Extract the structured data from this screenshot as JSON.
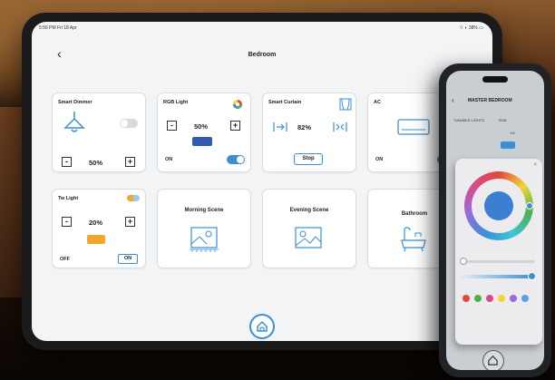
{
  "tablet": {
    "status_left": "5:56 PM Fri 18 Apr",
    "status_right": "⌔ ◐ 38% ▭",
    "back_icon": "‹",
    "title": "Bedroom",
    "cards": {
      "smart_dimmer": {
        "title": "Smart Dimmer",
        "percent": "50%",
        "minus": "-",
        "plus": "+"
      },
      "rgb_light": {
        "title": "RGB Light",
        "percent": "50%",
        "minus": "-",
        "plus": "+",
        "state": "ON",
        "color": "#2f5bb0"
      },
      "smart_curtain": {
        "title": "Smart Curtain",
        "percent": "82%",
        "stop": "Stop"
      },
      "ac": {
        "title": "AC",
        "state": "ON"
      },
      "tw_light": {
        "title": "Tw Light",
        "percent": "20%",
        "minus": "-",
        "plus": "+",
        "off": "OFF",
        "on": "ON",
        "color": "#f3a62e"
      },
      "morning_scene": {
        "title": "Morning Scene"
      },
      "evening_scene": {
        "title": "Evening Scene"
      },
      "bathroom": {
        "title": "Bathroom"
      }
    }
  },
  "phone": {
    "title": "MASTER BEDROOM",
    "tunable_label": "TUNABLE LIGHTS",
    "rgb_label": "RGB",
    "percent": "1%",
    "swatches": [
      "#e0493c",
      "#4caf50",
      "#d94a8c",
      "#f2d53c",
      "#9c6ad6",
      "#5aa0e8"
    ]
  },
  "colors": {
    "accent": "#3a8fd6",
    "toggle_on": "#3a8fd6",
    "toggle_off": "#d6d9de"
  }
}
